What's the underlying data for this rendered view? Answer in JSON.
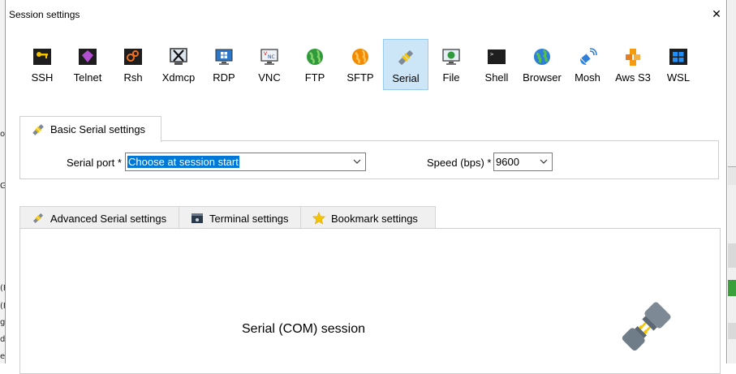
{
  "window": {
    "title": "Session settings",
    "close_glyph": "✕"
  },
  "session_types": [
    {
      "label": "SSH",
      "icon": "ssh-key-icon"
    },
    {
      "label": "Telnet",
      "icon": "telnet-icon"
    },
    {
      "label": "Rsh",
      "icon": "rsh-icon"
    },
    {
      "label": "Xdmcp",
      "icon": "xdmcp-icon"
    },
    {
      "label": "RDP",
      "icon": "rdp-monitor-icon"
    },
    {
      "label": "VNC",
      "icon": "vnc-monitor-icon"
    },
    {
      "label": "FTP",
      "icon": "ftp-globe-icon"
    },
    {
      "label": "SFTP",
      "icon": "sftp-globe-icon"
    },
    {
      "label": "Serial",
      "icon": "serial-plug-icon",
      "selected": true
    },
    {
      "label": "File",
      "icon": "file-monitor-icon"
    },
    {
      "label": "Shell",
      "icon": "shell-terminal-icon"
    },
    {
      "label": "Browser",
      "icon": "browser-globe-icon"
    },
    {
      "label": "Mosh",
      "icon": "mosh-satellite-icon"
    },
    {
      "label": "Aws S3",
      "icon": "aws-s3-cubes-icon"
    },
    {
      "label": "WSL",
      "icon": "wsl-windows-icon"
    }
  ],
  "basic": {
    "tab_label": "Basic Serial settings",
    "serial_port_label": "Serial port *",
    "serial_port_value": "Choose at session start",
    "speed_label": "Speed (bps) *",
    "speed_value": "9600"
  },
  "tabs": [
    {
      "label": "Advanced Serial settings",
      "icon": "serial-plug-icon"
    },
    {
      "label": "Terminal settings",
      "icon": "terminal-icon"
    },
    {
      "label": "Bookmark settings",
      "icon": "star-icon"
    }
  ],
  "content": {
    "session_title": "Serial (COM) session"
  },
  "background_fragments": [
    "ov",
    "G:",
    "(F",
    "(F",
    "g",
    "d",
    "e"
  ],
  "colors": {
    "selected_bg": "#cde6f7",
    "selected_border": "#99c9ef",
    "selection_highlight": "#0078d7"
  }
}
